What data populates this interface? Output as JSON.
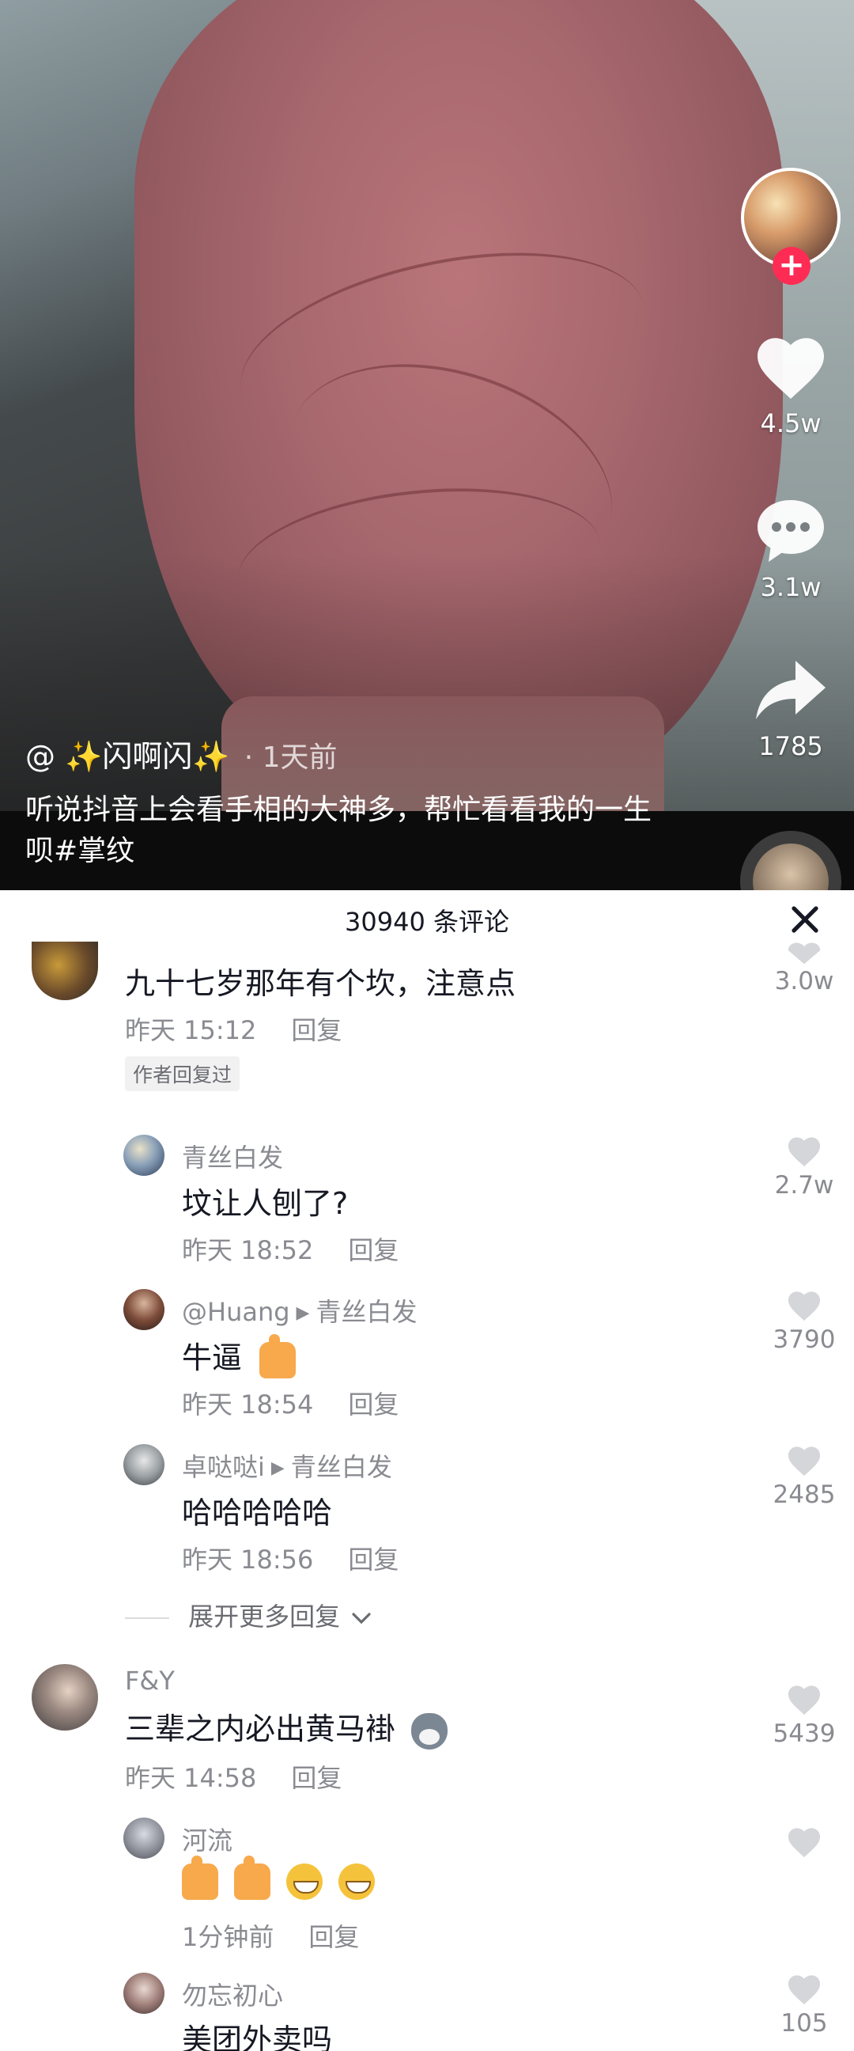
{
  "video": {
    "author_handle": "@ ✨闪啊闪✨",
    "post_time": "· 1天前",
    "caption": "听说抖音上会看手相的大神多，帮忙看看我的一生呗#掌纹",
    "likes": "4.5w",
    "comments": "3.1w",
    "shares": "1785",
    "follow_symbol": "+"
  },
  "sheet": {
    "title": "30940 条评论"
  },
  "comments": [
    {
      "text": "九十七岁那年有个坎，注意点",
      "time": "昨天 15:12",
      "reply": "回复",
      "likes": "3.0w",
      "author_badge": "作者回复过"
    },
    {
      "user": "青丝白发",
      "text": "坟让人刨了?",
      "time": "昨天 18:52",
      "reply": "回复",
      "likes": "2.7w"
    },
    {
      "user": "@Huang",
      "reply_to": "青丝白发",
      "text": "牛逼",
      "time": "昨天 18:54",
      "reply": "回复",
      "likes": "3790"
    },
    {
      "user": "卓哒哒i",
      "reply_to": "青丝白发",
      "text": "哈哈哈哈哈",
      "time": "昨天 18:56",
      "reply": "回复",
      "likes": "2485"
    },
    {
      "expand_label": "展开更多回复"
    },
    {
      "user": "F&Y",
      "text": "三辈之内必出黄马褂",
      "time": "昨天 14:58",
      "reply": "回复",
      "likes": "5439"
    },
    {
      "user": "河流",
      "time": "1分钟前",
      "reply": "回复"
    },
    {
      "user": "勿忘初心",
      "text": "美团外卖吗",
      "likes": "105"
    }
  ]
}
